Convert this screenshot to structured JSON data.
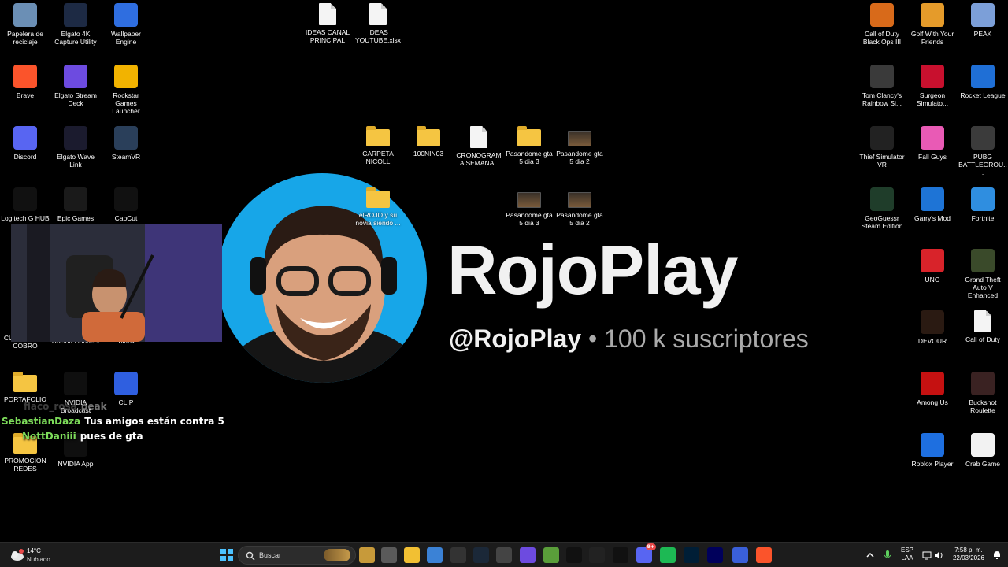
{
  "desktop_icons": [
    {
      "label": "Papelera de reciclaje",
      "icon": "recycle-bin-icon",
      "color": "#6b8fb5"
    },
    {
      "label": "Elgato 4K Capture Utility",
      "icon": "elgato-4k-icon",
      "color": "#1d2a44"
    },
    {
      "label": "Wallpaper Engine",
      "icon": "wallpaper-engine-icon",
      "color": "#2f6ee0"
    },
    {
      "label": "IDEAS CANAL PRINCIPAL",
      "icon": "document-icon",
      "color": "#f4f4f4"
    },
    {
      "label": "IDEAS YOUTUBE.xlsx",
      "icon": "document-icon",
      "color": "#f4f4f4"
    },
    {
      "label": "Call of Duty Black Ops III",
      "icon": "cod-bo3-icon",
      "color": "#d86a1a"
    },
    {
      "label": "Golf With Your Friends",
      "icon": "golf-icon",
      "color": "#e59b2a"
    },
    {
      "label": "PEAK",
      "icon": "peak-icon",
      "color": "#7c9fd8"
    },
    {
      "label": "Brave",
      "icon": "brave-icon",
      "color": "#fb542b"
    },
    {
      "label": "Elgato Stream Deck",
      "icon": "stream-deck-icon",
      "color": "#6d4be0"
    },
    {
      "label": "Rockstar Games Launcher",
      "icon": "rockstar-icon",
      "color": "#f2b300"
    },
    {
      "label": "Tom Clancy's Rainbow Si...",
      "icon": "rainbow-six-icon",
      "color": "#3a3a3a"
    },
    {
      "label": "Surgeon Simulato...",
      "icon": "surgeon-simulator-icon",
      "color": "#c8102e"
    },
    {
      "label": "Rocket League",
      "icon": "rocket-league-icon",
      "color": "#1f6fd6"
    },
    {
      "label": "Discord",
      "icon": "discord-icon",
      "color": "#5865f2"
    },
    {
      "label": "Elgato Wave Link",
      "icon": "wave-link-icon",
      "color": "#1b1b2e"
    },
    {
      "label": "SteamVR",
      "icon": "steamvr-icon",
      "color": "#2a3f5a"
    },
    {
      "label": "CARPETA NICOLL",
      "icon": "folder-icon",
      "color": "#f5c542"
    },
    {
      "label": "100NIN03",
      "icon": "folder-icon",
      "color": "#f5c542"
    },
    {
      "label": "CRONOGRAMA SEMANAL",
      "icon": "document-icon",
      "color": "#f4f4f4"
    },
    {
      "label": "Pasandome gta 5 dia 3",
      "icon": "folder-icon",
      "color": "#f5c542"
    },
    {
      "label": "Pasandome gta 5 dia 2",
      "icon": "video-thumbnail-icon",
      "color": "#5a4430"
    },
    {
      "label": "Thief Simulator VR",
      "icon": "thief-simulator-icon",
      "color": "#222222"
    },
    {
      "label": "Fall Guys",
      "icon": "fall-guys-icon",
      "color": "#e95ab5"
    },
    {
      "label": "PUBG BATTLEGROU...",
      "icon": "pubg-icon",
      "color": "#3b3b3b"
    },
    {
      "label": "Logitech G HUB",
      "icon": "logitech-icon",
      "color": "#111111"
    },
    {
      "label": "Epic Games",
      "icon": "epic-games-icon",
      "color": "#1a1a1a"
    },
    {
      "label": "CapCut",
      "icon": "capcut-icon",
      "color": "#111111"
    },
    {
      "label": "elROJO y su novia siendo ...",
      "icon": "folder-icon",
      "color": "#f5c542"
    },
    {
      "label": "Pasandome gta 5 dia 3",
      "icon": "video-thumbnail-icon",
      "color": "#6a5040"
    },
    {
      "label": "Pasandome gta 5 dia 2",
      "icon": "video-thumbnail-icon",
      "color": "#7a5535"
    },
    {
      "label": "GeoGuessr Steam Edition",
      "icon": "geoguessr-icon",
      "color": "#1f3d2a"
    },
    {
      "label": "Garry's Mod",
      "icon": "garrys-mod-icon",
      "color": "#1e74d6"
    },
    {
      "label": "Fortnite",
      "icon": "fortnite-icon",
      "color": "#2f8ee0"
    },
    {
      "label": "UNO",
      "icon": "uno-icon",
      "color": "#d8232a"
    },
    {
      "label": "Grand Theft Auto V Enhanced",
      "icon": "gta-v-icon",
      "color": "#3a4a2a"
    },
    {
      "label": "DEVOUR",
      "icon": "devour-icon",
      "color": "#2a1a12"
    },
    {
      "label": "Call of Duty",
      "icon": "document-icon",
      "color": "#f4f4f4"
    },
    {
      "label": "CUENTAS DE COBRO",
      "icon": "folder-icon",
      "color": "#f5c542"
    },
    {
      "label": "Ubisoft Connect",
      "icon": "ubisoft-icon",
      "color": "#1a1a1a"
    },
    {
      "label": "Tiktok",
      "icon": "tiktok-icon",
      "color": "#1a1a1a"
    },
    {
      "label": "PORTAFOLIO",
      "icon": "folder-icon",
      "color": "#f5c542"
    },
    {
      "label": "NVIDIA Broadcast",
      "icon": "nvidia-icon",
      "color": "#0f0f0f"
    },
    {
      "label": "CLIP",
      "icon": "clip-icon",
      "color": "#2f5fe0"
    },
    {
      "label": "Among Us",
      "icon": "among-us-icon",
      "color": "#c51111"
    },
    {
      "label": "Buckshot Roulette",
      "icon": "buckshot-icon",
      "color": "#3a2222"
    },
    {
      "label": "PROMOCION REDES",
      "icon": "folder-icon",
      "color": "#f5c542"
    },
    {
      "label": "NVIDIA App",
      "icon": "nvidia-icon",
      "color": "#0f0f0f"
    },
    {
      "label": "Roblox Player",
      "icon": "roblox-icon",
      "color": "#1e6fe0"
    },
    {
      "label": "Crab Game",
      "icon": "crab-game-icon",
      "color": "#f2f2f2"
    }
  ],
  "channel": {
    "name": "RojoPlay",
    "handle": "@RojoPlay",
    "separator": " • ",
    "subscribers": "100 k suscriptores"
  },
  "chat": [
    {
      "user": "flaco_rosa",
      "user_color": "#666666",
      "message": "peak",
      "faded": true
    },
    {
      "user": "SebastianDaza",
      "user_color": "#7ddc5a",
      "message": "Tus amigos están contra 5"
    },
    {
      "user": "NottDaniii",
      "user_color": "#7ddc5a",
      "message": "pues de gta"
    }
  ],
  "taskbar": {
    "weather_temp": "14°C",
    "weather_cond": "Nublado",
    "search_placeholder": "Buscar",
    "apps": [
      "windows-start-icon",
      "widgets-icon",
      "task-view-icon",
      "file-explorer-icon",
      "store-icon",
      "chatgpt-icon",
      "steam-icon",
      "obs-icon",
      "stream-deck-icon",
      "minecraft-icon",
      "tiktok-icon",
      "wave-link-icon",
      "logitech-icon",
      "discord-icon",
      "spotify-icon",
      "photoshop-icon",
      "media-encoder-icon",
      "vegas-icon",
      "brave-icon"
    ],
    "lang_top": "ESP",
    "lang_bottom": "LAA",
    "time": "7:58 p. m.",
    "date": "22/03/2026",
    "discord_badge": "9+"
  },
  "colors": {
    "accent": "#17a6e8",
    "taskbar": "#1c1c1c"
  }
}
